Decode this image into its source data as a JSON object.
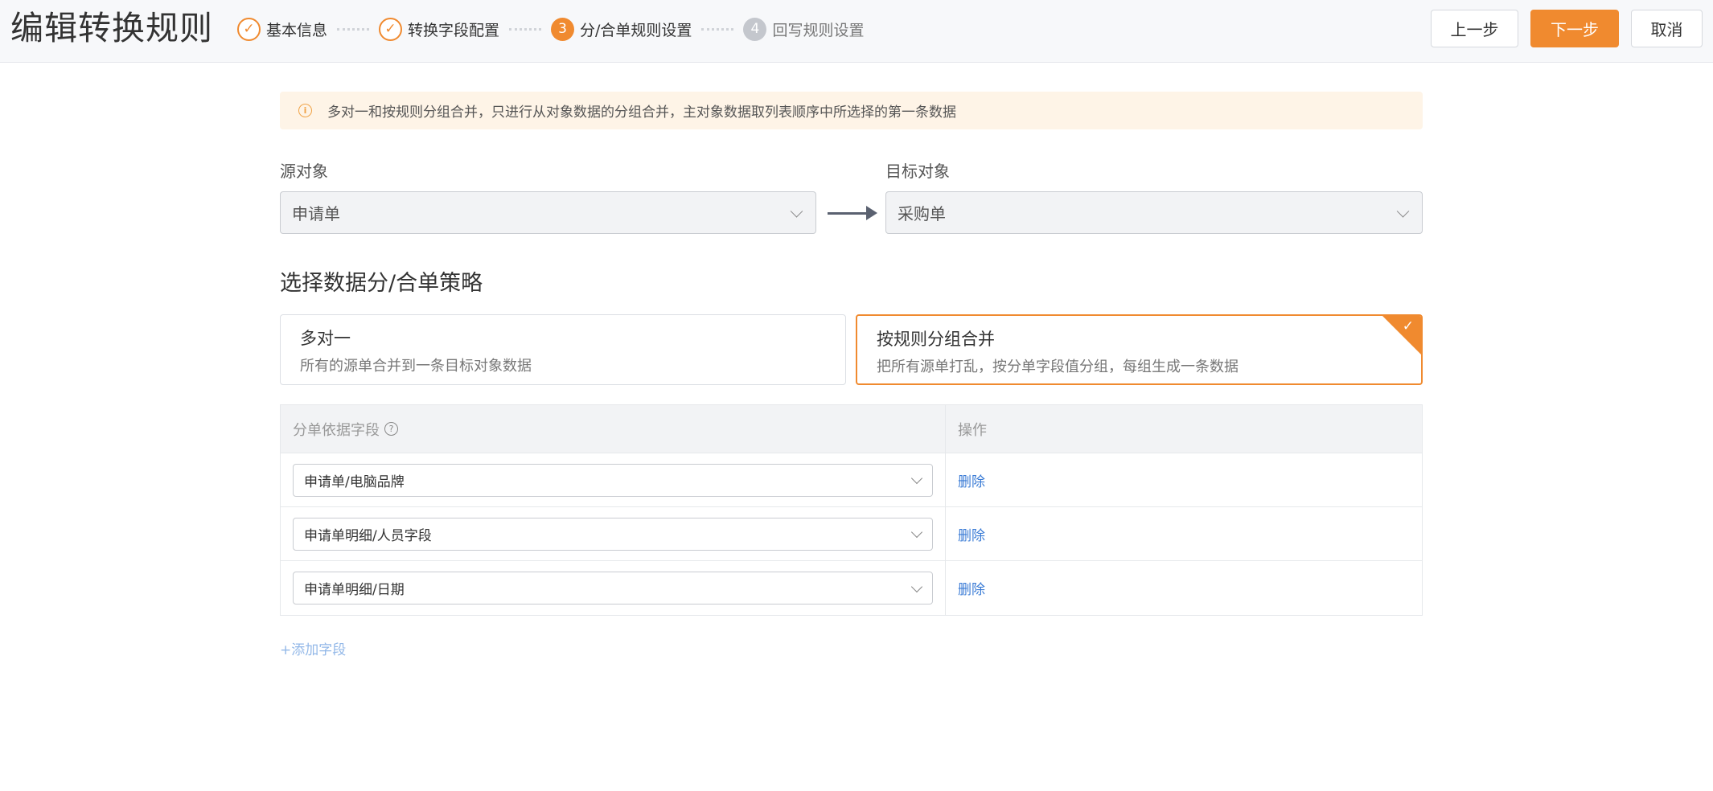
{
  "header": {
    "title": "编辑转换规则",
    "steps": [
      {
        "label": "基本信息",
        "status": "done",
        "marker": "✓"
      },
      {
        "label": "转换字段配置",
        "status": "done",
        "marker": "✓"
      },
      {
        "label": "分/合单规则设置",
        "status": "current",
        "marker": "3"
      },
      {
        "label": "回写规则设置",
        "status": "todo",
        "marker": "4"
      }
    ],
    "buttons": {
      "prev": "上一步",
      "next": "下一步",
      "cancel": "取消"
    }
  },
  "notice": {
    "icon": "i",
    "text": "多对一和按规则分组合并，只进行从对象数据的分组合并，主对象数据取列表顺序中所选择的第一条数据"
  },
  "objects": {
    "source_label": "源对象",
    "source_value": "申请单",
    "target_label": "目标对象",
    "target_value": "采购单"
  },
  "strategy": {
    "section_title": "选择数据分/合单策略",
    "options": [
      {
        "title": "多对一",
        "desc": "所有的源单合并到一条目标对象数据",
        "selected": false
      },
      {
        "title": "按规则分组合并",
        "desc": "把所有源单打乱，按分单字段值分组，每组生成一条数据",
        "selected": true
      }
    ]
  },
  "table": {
    "columns": {
      "field": "分单依据字段",
      "action": "操作"
    },
    "help_icon": "?",
    "rows": [
      {
        "field": "申请单/电脑品牌",
        "action": "删除"
      },
      {
        "field": "申请单明细/人员字段",
        "action": "删除"
      },
      {
        "field": "申请单明细/日期",
        "action": "删除"
      }
    ]
  },
  "add_field_label": "+添加字段",
  "colors": {
    "accent": "#f08a2f",
    "link": "#3a7bd5",
    "notice_bg": "#fef4e7"
  }
}
